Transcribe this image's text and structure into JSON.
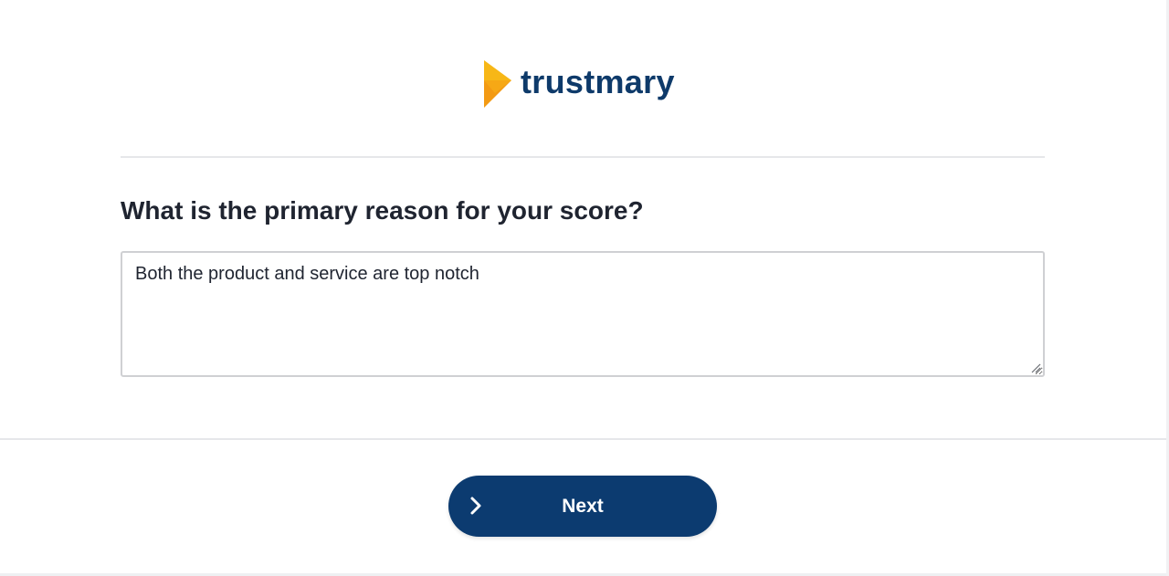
{
  "brand": {
    "name": "trustmary",
    "logo_icon": "trustmary-logo-icon",
    "text_color": "#0e3a6a",
    "accent_color": "#f6b21a"
  },
  "question": {
    "title": "What is the primary reason for your score?"
  },
  "answer": {
    "value": "Both the product and service are top notch"
  },
  "footer": {
    "next_label": "Next",
    "next_icon": "chevron-right-icon",
    "button_color": "#0c3b70"
  }
}
